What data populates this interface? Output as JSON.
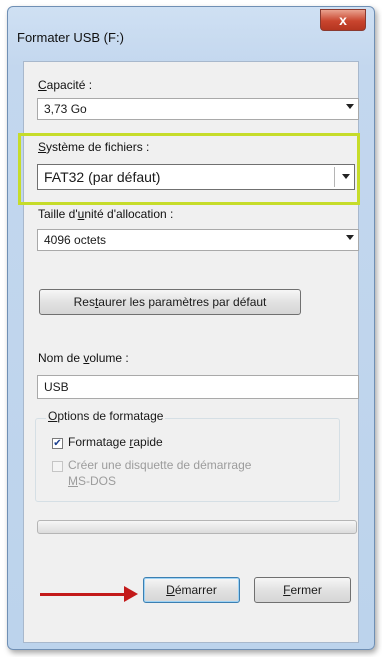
{
  "window": {
    "title": "Formater USB (F:)",
    "close_glyph": "x"
  },
  "capacity": {
    "label_accel": "C",
    "label_rest": "apacité :",
    "value": "3,73 Go"
  },
  "filesystem": {
    "label_accel": "S",
    "label_rest": "ystème de fichiers :",
    "value": "FAT32 (par défaut)",
    "highlight_color": "#c6dc2a"
  },
  "allocation": {
    "label_pre": "Taille d'",
    "label_accel": "u",
    "label_post": "nité d'allocation :",
    "value": "4096 octets"
  },
  "restore_button": {
    "pre": "Res",
    "accel": "t",
    "post": "aurer les paramètres par défaut"
  },
  "volume": {
    "label_pre": "Nom de ",
    "label_accel": "v",
    "label_post": "olume :",
    "value": "USB"
  },
  "options": {
    "legend_accel": "O",
    "legend_rest": "ptions de formatage",
    "quick_format": {
      "pre": "Formatage ",
      "accel": "r",
      "post": "apide",
      "checked": true
    },
    "boot_disk": {
      "pre": "Créer une disquette de démarrage",
      "line2_accel": "M",
      "line2_rest": "S-DOS",
      "checked": false,
      "enabled": false
    }
  },
  "progress": {
    "fraction": 0.0
  },
  "buttons": {
    "start": {
      "accel": "D",
      "rest": "émarrer"
    },
    "close": {
      "accel": "F",
      "rest": "ermer"
    }
  },
  "annotation": {
    "arrow_color": "#c31a1a"
  }
}
